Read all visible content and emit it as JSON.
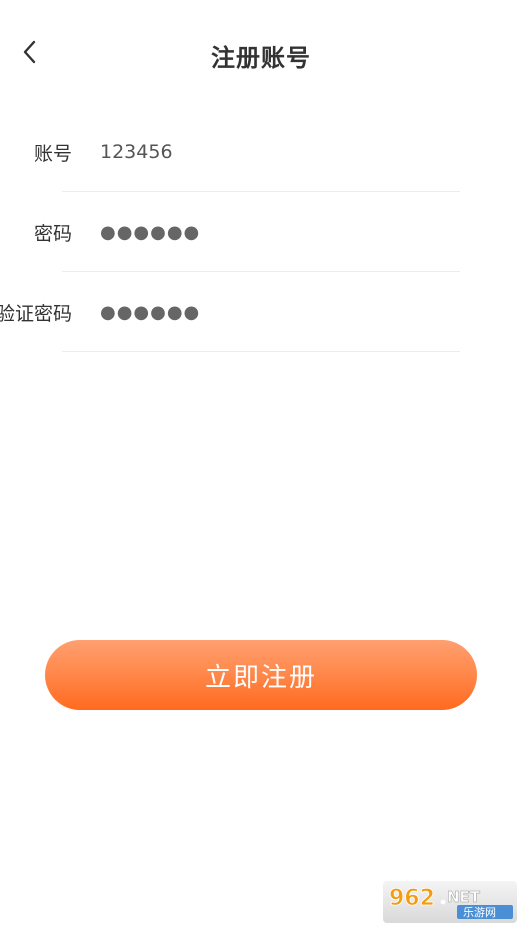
{
  "header": {
    "title": "注册账号",
    "back_icon": "chevron-left-icon"
  },
  "form": {
    "account": {
      "label": "账号",
      "value": "123456"
    },
    "password": {
      "label": "密码",
      "value": "●●●●●●"
    },
    "confirm_password": {
      "label": "验证密码",
      "value": "●●●●●●"
    }
  },
  "actions": {
    "register_label": "立即注册"
  },
  "watermark": {
    "brand": "962.NET",
    "sub": "乐游网"
  },
  "colors": {
    "accent_top": "#ff9f70",
    "accent_bottom": "#ff6a1f",
    "text": "#333333",
    "divider": "#ececec"
  }
}
